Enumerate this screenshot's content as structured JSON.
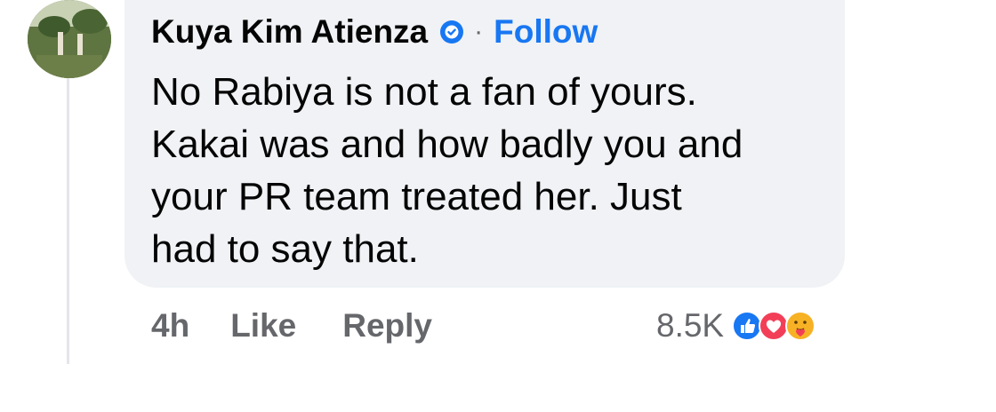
{
  "comment": {
    "author": "Kuya Kim Atienza",
    "follow_label": "Follow",
    "separator": "·",
    "text": "No Rabiya is not a fan of yours.\nKakai was and how badly you and\nyour PR team treated her. Just\nhad to say that.",
    "time": "4h",
    "like_label": "Like",
    "reply_label": "Reply",
    "reaction_count": "8.5K",
    "reactions": [
      "like-icon",
      "love-icon",
      "care-icon"
    ]
  },
  "colors": {
    "bubble": "#f0f2f5",
    "link": "#1877f2",
    "muted": "#65676b",
    "verified": "#1877f2"
  }
}
